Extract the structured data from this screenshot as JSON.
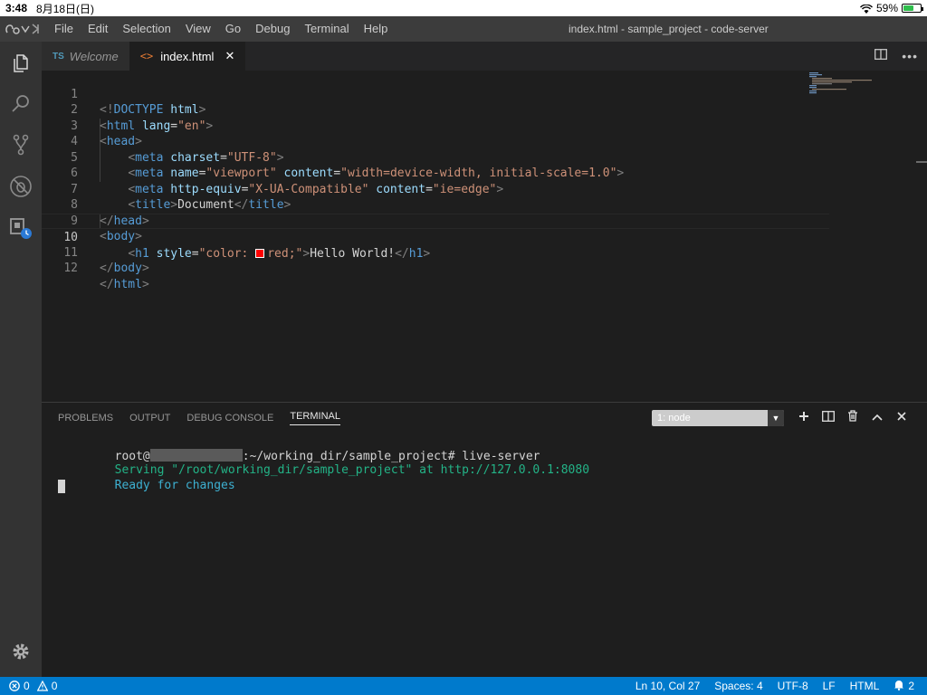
{
  "ios": {
    "time": "3:48",
    "date": "8月18日(日)",
    "battery": "59%",
    "battery_level": 0.59
  },
  "app": {
    "title": "index.html - sample_project - code-server"
  },
  "menu": [
    "File",
    "Edit",
    "Selection",
    "View",
    "Go",
    "Debug",
    "Terminal",
    "Help"
  ],
  "tabs": [
    {
      "badge": "TS",
      "label": "Welcome",
      "active": false
    },
    {
      "icon": "<>",
      "label": "index.html",
      "active": true
    }
  ],
  "editor": {
    "current_line": 10,
    "lines": [
      "1",
      "2",
      "3",
      "4",
      "5",
      "6",
      "7",
      "8",
      "9",
      "10",
      "11",
      "12"
    ],
    "code": {
      "l1": {
        "br1": "<!",
        "tag": "DOCTYPE",
        "rest": " html",
        "br2": ">"
      },
      "l2": {
        "tag": "html",
        "attr": "lang",
        "eq": "=",
        "val": "\"en\""
      },
      "l3": {
        "tag": "head"
      },
      "l4": {
        "tag": "meta",
        "attr": "charset",
        "val": "\"UTF-8\""
      },
      "l5": {
        "tag": "meta",
        "attr1": "name",
        "val1": "\"viewport\"",
        "attr2": "content",
        "val2": "\"width=device-width, initial-scale=1.0\""
      },
      "l6": {
        "tag": "meta",
        "attr1": "http-equiv",
        "val1": "\"X-UA-Compatible\"",
        "attr2": "content",
        "val2": "\"ie=edge\""
      },
      "l7": {
        "tag": "title",
        "text": "Document"
      },
      "l8": {
        "tag": "head"
      },
      "l9": {
        "tag": "body"
      },
      "l10": {
        "tag": "h1",
        "attr": "style",
        "val_open": "\"color: ",
        "val_close": "red;\"",
        "text": "Hello World!"
      },
      "l11": {
        "tag": "body"
      },
      "l12": {
        "tag": "html"
      }
    }
  },
  "panel": {
    "tabs": [
      "PROBLEMS",
      "OUTPUT",
      "DEBUG CONSOLE",
      "TERMINAL"
    ],
    "active_tab": "TERMINAL",
    "terminal_select": "1: node",
    "terminal": {
      "prompt_user": "root@",
      "prompt_path": ":~/working_dir/sample_project# ",
      "command": "live-server",
      "serving_prefix": "Serving ",
      "serving_path": "\"/root/working_dir/sample_project\"",
      "serving_at": " at ",
      "serving_url": "http://127.0.0.1:8080",
      "ready": "Ready for changes"
    }
  },
  "status": {
    "errors": "0",
    "warnings": "0",
    "position": "Ln 10, Col 27",
    "spaces": "Spaces: 4",
    "encoding": "UTF-8",
    "eol": "LF",
    "language": "HTML",
    "notifications": "2"
  },
  "colors": {
    "status_bar": "#007acc",
    "activity_bar": "#333333",
    "editor_bg": "#1e1e1e",
    "tag": "#569cd6",
    "attr": "#9cdcfe",
    "string": "#ce9178"
  }
}
